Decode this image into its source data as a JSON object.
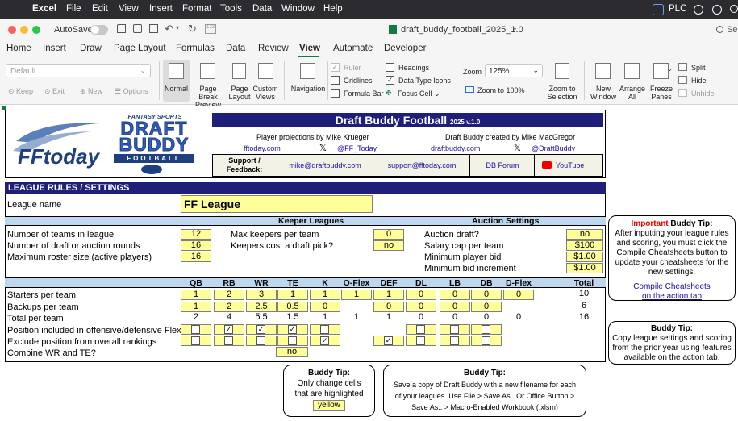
{
  "menubar": {
    "app": "Excel",
    "items": [
      "File",
      "Edit",
      "View",
      "Insert",
      "Format",
      "Tools",
      "Data",
      "Window",
      "Help"
    ],
    "account": "PLC"
  },
  "window": {
    "autosave": "AutoSave",
    "filename": "draft_buddy_football_2025_1.0",
    "search": "Se"
  },
  "tabs": [
    "Home",
    "Insert",
    "Draw",
    "Page Layout",
    "Formulas",
    "Data",
    "Review",
    "View",
    "Automate",
    "Developer"
  ],
  "active_tab": "View",
  "ribbon": {
    "view_select": "Default",
    "keep": "Keep",
    "exit": "Exit",
    "new": "New",
    "options": "Options",
    "normal": "Normal",
    "page_break": "Page Break\nPreview",
    "page_layout": "Page\nLayout",
    "custom_views": "Custom\nViews",
    "navigation": "Navigation",
    "ruler": "Ruler",
    "gridlines": "Gridlines",
    "formula_bar": "Formula Bar",
    "headings": "Headings",
    "data_type_icons": "Data Type Icons",
    "focus_cell": "Focus Cell",
    "zoom_label": "Zoom",
    "zoom_value": "125%",
    "zoom_100": "Zoom to 100%",
    "zoom_selection": "Zoom to\nSelection",
    "new_window": "New\nWindow",
    "arrange_all": "Arrange\nAll",
    "freeze_panes": "Freeze\nPanes",
    "split": "Split",
    "hide": "Hide",
    "unhide": "Unhide"
  },
  "header": {
    "fantasy_sports": "FANTASY SPORTS",
    "logo_draft": "DRAFT",
    "logo_buddy": "BUDDY",
    "logo_football": "FOOTBALL",
    "fftoday_logo": "FFtoday",
    "title": "Draft Buddy Football",
    "version": "2025 v.1.0",
    "projections_by": "Player projections by Mike Krueger",
    "created_by": "Draft Buddy created by Mike MacGregor",
    "fftoday_link": "fftoday.com",
    "fftoday_x": "@FF_Today",
    "draftbuddy_link": "draftbuddy.com",
    "draftbuddy_x": "@DraftBuddy",
    "support_label": "Support /\nFeedback:",
    "mike_email": "mike@draftbuddy.com",
    "support_email": "support@fftoday.com",
    "db_forum": "DB Forum",
    "youtube": "YouTube"
  },
  "league": {
    "section_title": "LEAGUE RULES / SETTINGS",
    "name_label": "League name",
    "name_value": "FF League",
    "keeper_header": "Keeper Leagues",
    "auction_header": "Auction Settings",
    "teams_label": "Number of teams in league",
    "teams_value": "12",
    "rounds_label": "Number of draft or auction rounds",
    "rounds_value": "16",
    "roster_label": "Maximum roster size (active players)",
    "roster_value": "16",
    "max_keepers_label": "Max keepers per team",
    "max_keepers_value": "0",
    "keepers_cost_label": "Keepers cost a draft pick?",
    "keepers_cost_value": "no",
    "auction_label": "Auction draft?",
    "auction_value": "no",
    "salary_label": "Salary cap per team",
    "salary_value": "$100",
    "min_bid_label": "Minimum player bid",
    "min_bid_value": "$1.00",
    "min_inc_label": "Minimum bid increment",
    "min_inc_value": "$1.00"
  },
  "positions": {
    "columns": [
      "QB",
      "RB",
      "WR",
      "TE",
      "K",
      "O-Flex",
      "DEF",
      "DL",
      "LB",
      "DB",
      "D-Flex",
      "Total"
    ],
    "starters_label": "Starters per team",
    "starters": [
      "1",
      "2",
      "3",
      "1",
      "1",
      "1",
      "1",
      "0",
      "0",
      "0",
      "0",
      "10"
    ],
    "backups_label": "Backups per team",
    "backups": [
      "1",
      "2",
      "2.5",
      "0.5",
      "0",
      "",
      "0",
      "0",
      "0",
      "0",
      "",
      "6"
    ],
    "total_label": "Total per team",
    "totals": [
      "2",
      "4",
      "5.5",
      "1.5",
      "1",
      "1",
      "1",
      "0",
      "0",
      "0",
      "0",
      "16"
    ],
    "flex_label": "Position included in offensive/defensive Flex",
    "flex_checks": [
      false,
      true,
      true,
      true,
      false,
      null,
      null,
      false,
      false,
      false,
      null
    ],
    "exclude_label": "Exclude position from overall rankings",
    "exclude_checks": [
      false,
      false,
      false,
      false,
      true,
      null,
      true,
      false,
      false,
      false,
      null
    ],
    "combine_label": "Combine WR and TE?",
    "combine_value": "no"
  },
  "tips": {
    "tip_title": "Buddy Tip:",
    "important": "Important",
    "tip1": "After inputting your league rules and scoring, you must click the Compile Cheatsheets button to update your cheatsheets for the new settings.",
    "tip1_link1": "Compile Cheatsheets",
    "tip1_link2": "on the action tab",
    "tip2": "Copy league settings and scoring from the prior year using features available on the action tab.",
    "tip3_line1": "Only change cells",
    "tip3_line2": "that are highlighted",
    "tip3_yellow": "yellow",
    "tip4": "Save a copy of Draft Buddy with a new filename for each of your leagues. Use File > Save As.. Or Office Button > Save As.. > Macro-Enabled Workbook (.xlsm)"
  },
  "colors": {
    "navy": "#1f1f7a",
    "yellow": "#ffff99",
    "band": "#bdd7ee",
    "excel_green": "#107c41"
  }
}
